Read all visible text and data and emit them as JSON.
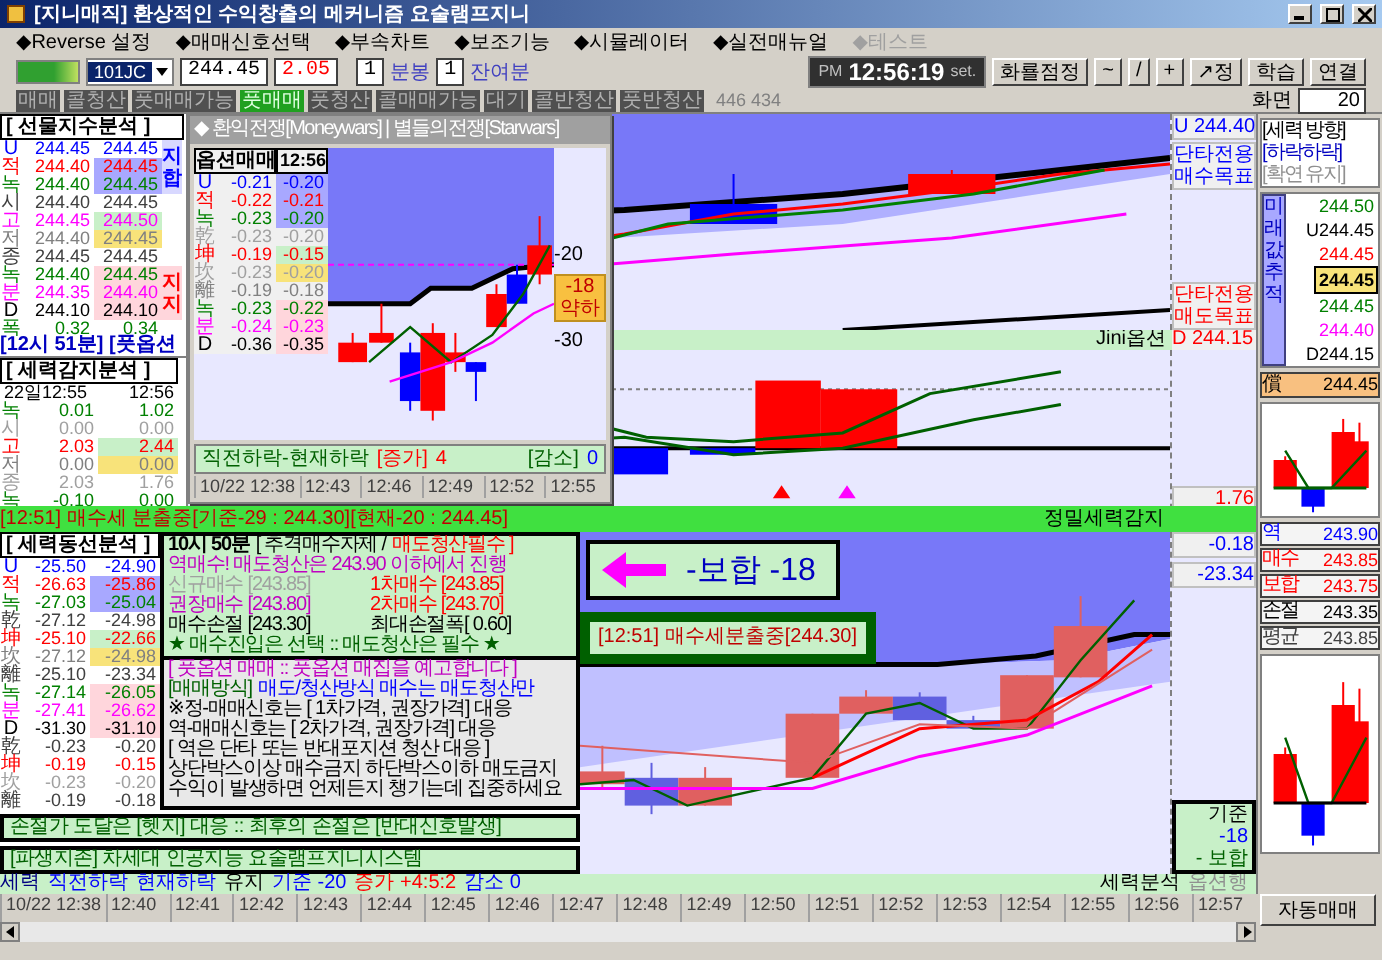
{
  "window": {
    "title": "[지니매직] 환상적인 수익창출의 메커니즘 요술램프지니"
  },
  "menu": [
    {
      "label": "◆Reverse 설정",
      "disabled": false
    },
    {
      "label": "◆매매신호선택",
      "disabled": false
    },
    {
      "label": "◆부속차트",
      "disabled": false
    },
    {
      "label": "◆보조기능",
      "disabled": false
    },
    {
      "label": "◆시뮬레이터",
      "disabled": false
    },
    {
      "label": "◆실전매뉴얼",
      "disabled": false
    },
    {
      "label": "◆테스트",
      "disabled": true
    }
  ],
  "toolbar": {
    "symbol": "101JC",
    "price": "244.45",
    "change": "2.05",
    "interval": "1",
    "interval_unit": "분봉",
    "remaining": "1",
    "remaining_unit": "잔여분",
    "clock": {
      "ampm": "PM",
      "time": "12:56:19",
      "set": "set."
    },
    "buttons": [
      "화룔점정",
      "~",
      "/",
      "+",
      "↗정",
      "학습",
      "연결"
    ]
  },
  "signals": [
    {
      "label": "매매",
      "active": false
    },
    {
      "label": "콜청산",
      "active": false
    },
    {
      "label": "풋매매가능",
      "active": false
    },
    {
      "label": "풋매매",
      "active": true
    },
    {
      "label": "풋청산",
      "active": false
    },
    {
      "label": "콜매매가능",
      "active": false
    },
    {
      "label": "대기",
      "active": false
    },
    {
      "label": "콜반청산",
      "active": false
    },
    {
      "label": "풋반청산",
      "active": false
    }
  ],
  "signal_counts": "446 434",
  "screen": {
    "label": "화면",
    "value": "20"
  },
  "futures_index": {
    "title": "[ 선물지수분석 ]",
    "rows": [
      {
        "label": "U",
        "color": "#0000ff",
        "values": [
          "244.45",
          "244.45"
        ],
        "kind": "white"
      },
      {
        "label": "적",
        "color": "#ff0000",
        "values": [
          "244.40",
          "244.45"
        ],
        "kind": "blue"
      },
      {
        "label": "녹",
        "color": "#008000",
        "values": [
          "244.40",
          "244.45"
        ],
        "kind": "blue"
      },
      {
        "label": "시",
        "color": "#404040",
        "values": [
          "244.40",
          "244.45"
        ],
        "kind": "white"
      },
      {
        "label": "고",
        "color": "#ff00ff",
        "values": [
          "244.45",
          "244.50"
        ],
        "kind": "green"
      },
      {
        "label": "저",
        "color": "#808080",
        "values": [
          "244.40",
          "244.45"
        ],
        "kind": "yellow"
      },
      {
        "label": "종",
        "color": "#404040",
        "values": [
          "244.45",
          "244.45"
        ],
        "kind": "plain"
      },
      {
        "label": "녹",
        "color": "#008000",
        "values": [
          "244.40",
          "244.45"
        ],
        "kind": "pink"
      },
      {
        "label": "분",
        "color": "#ff00ff",
        "values": [
          "244.35",
          "244.40"
        ],
        "kind": "pink"
      },
      {
        "label": "D",
        "color": "#000000",
        "values": [
          "244.10",
          "244.10"
        ],
        "kind": "pink"
      },
      {
        "label": "폭",
        "color": "#008000",
        "values": [
          "0.32",
          "0.34"
        ],
        "kind": "plain"
      }
    ],
    "side_labels": [
      {
        "text": "지합",
        "color": "#0000ff"
      },
      {
        "text": "지지",
        "color": "#ff0000"
      }
    ]
  },
  "notice_left": "[12시 51분] [풋옵션",
  "force_detect": {
    "title": "[ 세력감지분석 ]",
    "header": [
      "22일12:55",
      "12:56"
    ],
    "rows": [
      {
        "label": "녹",
        "color": "#008000",
        "values": [
          "0.01",
          "1.02"
        ],
        "kind": "plain"
      },
      {
        "label": "시",
        "color": "#a0a0a0",
        "values": [
          "0.00",
          "0.00"
        ],
        "kind": "plain"
      },
      {
        "label": "고",
        "color": "#ff0000",
        "values": [
          "2.03",
          "2.44"
        ],
        "kind": "green"
      },
      {
        "label": "저",
        "color": "#808080",
        "values": [
          "0.00",
          "0.00"
        ],
        "kind": "yellow"
      },
      {
        "label": "종",
        "color": "#a0a0a0",
        "values": [
          "2.03",
          "1.76"
        ],
        "kind": "plain"
      },
      {
        "label": "녹",
        "color": "#008000",
        "values": [
          "-0.10",
          "0.00"
        ],
        "kind": "plain"
      }
    ]
  },
  "popup": {
    "title": "◆ 환익전쟁[Moneywars] | 별들의전쟁[Starwars]",
    "table": {
      "header": [
        "옵션매매",
        "12:56"
      ],
      "rows": [
        {
          "label": "U",
          "color": "#0000ff",
          "values": [
            "-0.21",
            "-0.20"
          ],
          "kind": "blue"
        },
        {
          "label": "적",
          "color": "#ff0000",
          "values": [
            "-0.22",
            "-0.21"
          ],
          "kind": "blue"
        },
        {
          "label": "녹",
          "color": "#008000",
          "values": [
            "-0.23",
            "-0.20"
          ],
          "kind": "blue"
        },
        {
          "label": "乾",
          "color": "#a0a0a0",
          "values": [
            "-0.23",
            "-0.20"
          ],
          "kind": "plain"
        },
        {
          "label": "坤",
          "color": "#ff0000",
          "values": [
            "-0.19",
            "-0.15"
          ],
          "kind": "green"
        },
        {
          "label": "坎",
          "color": "#a0a0a0",
          "values": [
            "-0.23",
            "-0.20"
          ],
          "kind": "yellow"
        },
        {
          "label": "離",
          "color": "#808080",
          "values": [
            "-0.19",
            "-0.18"
          ],
          "kind": "plain"
        },
        {
          "label": "녹",
          "color": "#008000",
          "values": [
            "-0.23",
            "-0.22"
          ],
          "kind": "pink"
        },
        {
          "label": "분",
          "color": "#ff00ff",
          "values": [
            "-0.24",
            "-0.23"
          ],
          "kind": "pink"
        },
        {
          "label": "D",
          "color": "#000000",
          "values": [
            "-0.36",
            "-0.35"
          ],
          "kind": "pink"
        }
      ]
    },
    "axis_labels": [
      "-20",
      "-30"
    ],
    "badge": {
      "value": "-18",
      "text": "약하"
    },
    "footer": {
      "label": "직전하락-현재하락",
      "increase_label": "[증가]",
      "increase": "4",
      "decrease_label": "[감소]",
      "decrease": "0"
    },
    "times": [
      "10/22 12:38",
      "12:43",
      "12:46",
      "12:49",
      "12:52",
      "12:55"
    ]
  },
  "top_chart": {
    "upper": "U 244.40",
    "buy_target": "단타전용 매수목표",
    "sell_target": "단타전용 매도목표",
    "footer": "Jini옵션",
    "lower": "D 244.15"
  },
  "mid_chart": {
    "reading": "1.76",
    "footer": "정밀세력감지"
  },
  "alert_bar": "[12:51] 매수세 분출중[기준-29 : 244.30][현재-20 : 244.45]",
  "right_panel": {
    "direction": {
      "title": "[세력 방향]",
      "state": "[하락하락]",
      "sub": "[확연 유지]"
    },
    "track_label": "미래값추적",
    "levels": [
      {
        "text": "244.50",
        "color": "#008000",
        "selected": false
      },
      {
        "text": "U244.45",
        "color": "#000000",
        "selected": false
      },
      {
        "text": "244.45",
        "color": "#ff0000",
        "selected": false
      },
      {
        "text": "244.45",
        "color": "#000000",
        "selected": true
      },
      {
        "text": "244.45",
        "color": "#008000",
        "selected": false
      },
      {
        "text": "244.40",
        "color": "#ff00ff",
        "selected": false
      },
      {
        "text": "D244.15",
        "color": "#000000",
        "selected": false
      }
    ],
    "current": {
      "label": "償",
      "value": "244.45"
    },
    "targets": [
      {
        "label": "역",
        "value": "243.90",
        "color": "#0000ff"
      },
      {
        "label": "매수",
        "value": "243.85",
        "color": "#ff0000"
      },
      {
        "label": "보합",
        "value": "243.75",
        "color": "#ff0000"
      },
      {
        "label": "손절",
        "value": "243.35",
        "color": "#000000"
      },
      {
        "label": "평균",
        "value": "243.85",
        "color": "#404040"
      }
    ]
  },
  "trend_table": {
    "title": "[ 세력동선분석 ]",
    "rows": [
      {
        "label": "U",
        "color": "#0000ff",
        "values": [
          "-25.50",
          "-24.90"
        ],
        "kind": "white"
      },
      {
        "label": "적",
        "color": "#ff0000",
        "values": [
          "-26.63",
          "-25.86"
        ],
        "kind": "blue"
      },
      {
        "label": "녹",
        "color": "#008000",
        "values": [
          "-27.03",
          "-25.04"
        ],
        "kind": "blue"
      },
      {
        "label": "乾",
        "color": "#404040",
        "values": [
          "-27.12",
          "-24.98"
        ],
        "kind": "plain"
      },
      {
        "label": "坤",
        "color": "#ff0000",
        "values": [
          "-25.10",
          "-22.66"
        ],
        "kind": "green"
      },
      {
        "label": "坎",
        "color": "#808080",
        "values": [
          "-27.12",
          "-24.98"
        ],
        "kind": "yellow"
      },
      {
        "label": "離",
        "color": "#404040",
        "values": [
          "-25.10",
          "-23.34"
        ],
        "kind": "plain"
      },
      {
        "label": "녹",
        "color": "#008000",
        "values": [
          "-27.14",
          "-26.05"
        ],
        "kind": "pink"
      },
      {
        "label": "분",
        "color": "#ff00ff",
        "values": [
          "-27.41",
          "-26.62"
        ],
        "kind": "pink"
      },
      {
        "label": "D",
        "color": "#000000",
        "values": [
          "-31.30",
          "-31.10"
        ],
        "kind": "pink"
      },
      {
        "label": "乾",
        "color": "#404040",
        "values": [
          "-0.23",
          "-0.20"
        ],
        "kind": "plain"
      },
      {
        "label": "坤",
        "color": "#ff0000",
        "values": [
          "-0.19",
          "-0.15"
        ],
        "kind": "plain"
      },
      {
        "label": "坎",
        "color": "#a0a0a0",
        "values": [
          "-0.23",
          "-0.20"
        ],
        "kind": "plain"
      },
      {
        "label": "離",
        "color": "#404040",
        "values": [
          "-0.19",
          "-0.18"
        ],
        "kind": "plain"
      }
    ]
  },
  "info": {
    "heading": [
      "10시 50분",
      "[ 추격매수자제 /",
      "매도청산필수 ]"
    ],
    "lead": "역매수! 매도청산은 243.90 이하에서 진행",
    "prices": [
      {
        "text": "신규매수 [243.85]",
        "color": "#a0a0a0"
      },
      {
        "text": "1차매수 [243.85]",
        "color": "#ff0000"
      },
      {
        "text": "권장매수 [243.80]",
        "color": "#c000c0"
      },
      {
        "text": "2차매수 [243.70]",
        "color": "#ff0000"
      },
      {
        "text": "매수손절 [243.30]",
        "color": "#000000"
      },
      {
        "text": "최대손절폭[ 0.60]",
        "color": "#000000"
      }
    ],
    "motto": "★ 매수진입은 선택 :: 매도청산은 필수 ★",
    "guide_title": "[ 풋옵션 매매 :: 풋옵션 매집을 예고합니다 ]",
    "method_label": "[매매방식]",
    "method": "매도/청산방식 매수는 매도청산만",
    "lines": [
      "※정-매매신호는 [ 1차가격, 권장가격] 대응",
      "역-매매신호는 [ 2차가격, 권장가격] 대응",
      "[ 역은 단타 또는 반대포지션 청산 대응 ]",
      "상단박스이상 매수금지 하단박스이하 매도금지",
      "수익이 발생하면 언제든지 챙기는데 집중하세요"
    ]
  },
  "bars": [
    "손절가 도달은 [헷지] 대응 :: 최후의 손절은 [반대신호발생]",
    "[파생지존] 차세대 인공지능 요술램프지니시스템"
  ],
  "callout": {
    "text": "-보합 -18",
    "signal": "[12:51] 매수세분출중[244.30]"
  },
  "lower_chart": {
    "readings": [
      "-0.18",
      "-23.34"
    ],
    "basis": [
      "기준",
      "-18",
      "- 보합"
    ],
    "footer_left": "세력분석",
    "footer_right": "옵션행"
  },
  "status": [
    {
      "text": "세력",
      "color": "#000080"
    },
    {
      "text": "직전하락",
      "color": "#0000ff"
    },
    {
      "text": "현재하락",
      "color": "#0000ff"
    },
    {
      "text": "유지",
      "color": "#000000"
    },
    {
      "text": "기준 -20",
      "color": "#0000ff"
    },
    {
      "text": "증가 +4:5:2",
      "color": "#ff0000"
    },
    {
      "text": "감소 0",
      "color": "#0000ff"
    }
  ],
  "times": [
    "10/22 12:38",
    "12:40",
    "12:41",
    "12:42",
    "12:43",
    "12:44",
    "12:45",
    "12:46",
    "12:47",
    "12:48",
    "12:49",
    "12:50",
    "12:51",
    "12:52",
    "12:53",
    "12:54",
    "12:55",
    "12:56",
    "12:57"
  ],
  "auto_trade": "자동매매"
}
